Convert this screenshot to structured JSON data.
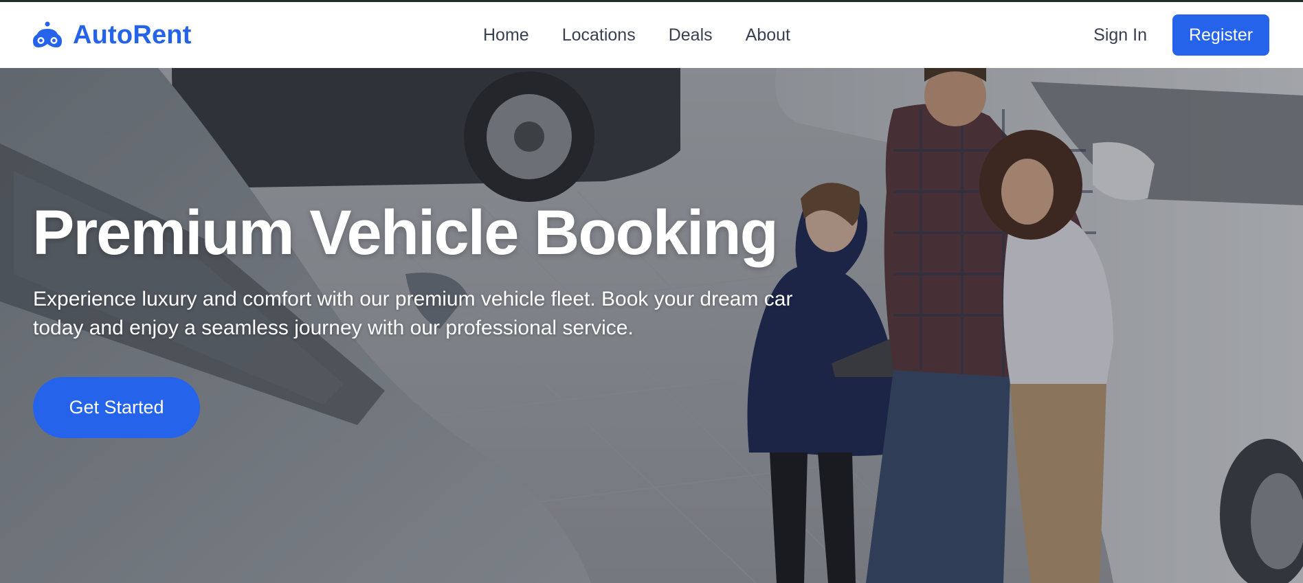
{
  "brand": {
    "name": "AutoRent",
    "icon": "car-front-icon",
    "color": "#2563eb"
  },
  "nav": {
    "links": [
      "Home",
      "Locations",
      "Deals",
      "About"
    ]
  },
  "auth": {
    "signin_label": "Sign In",
    "register_label": "Register"
  },
  "hero": {
    "title": "Premium Vehicle Booking",
    "subtitle": "Experience luxury and comfort with our premium vehicle fleet. Book your dream car today and enjoy a seamless journey with our professional service.",
    "cta_label": "Get Started",
    "image": "car-showroom-photo"
  },
  "colors": {
    "accent": "#2563eb",
    "nav_text": "#374151"
  }
}
